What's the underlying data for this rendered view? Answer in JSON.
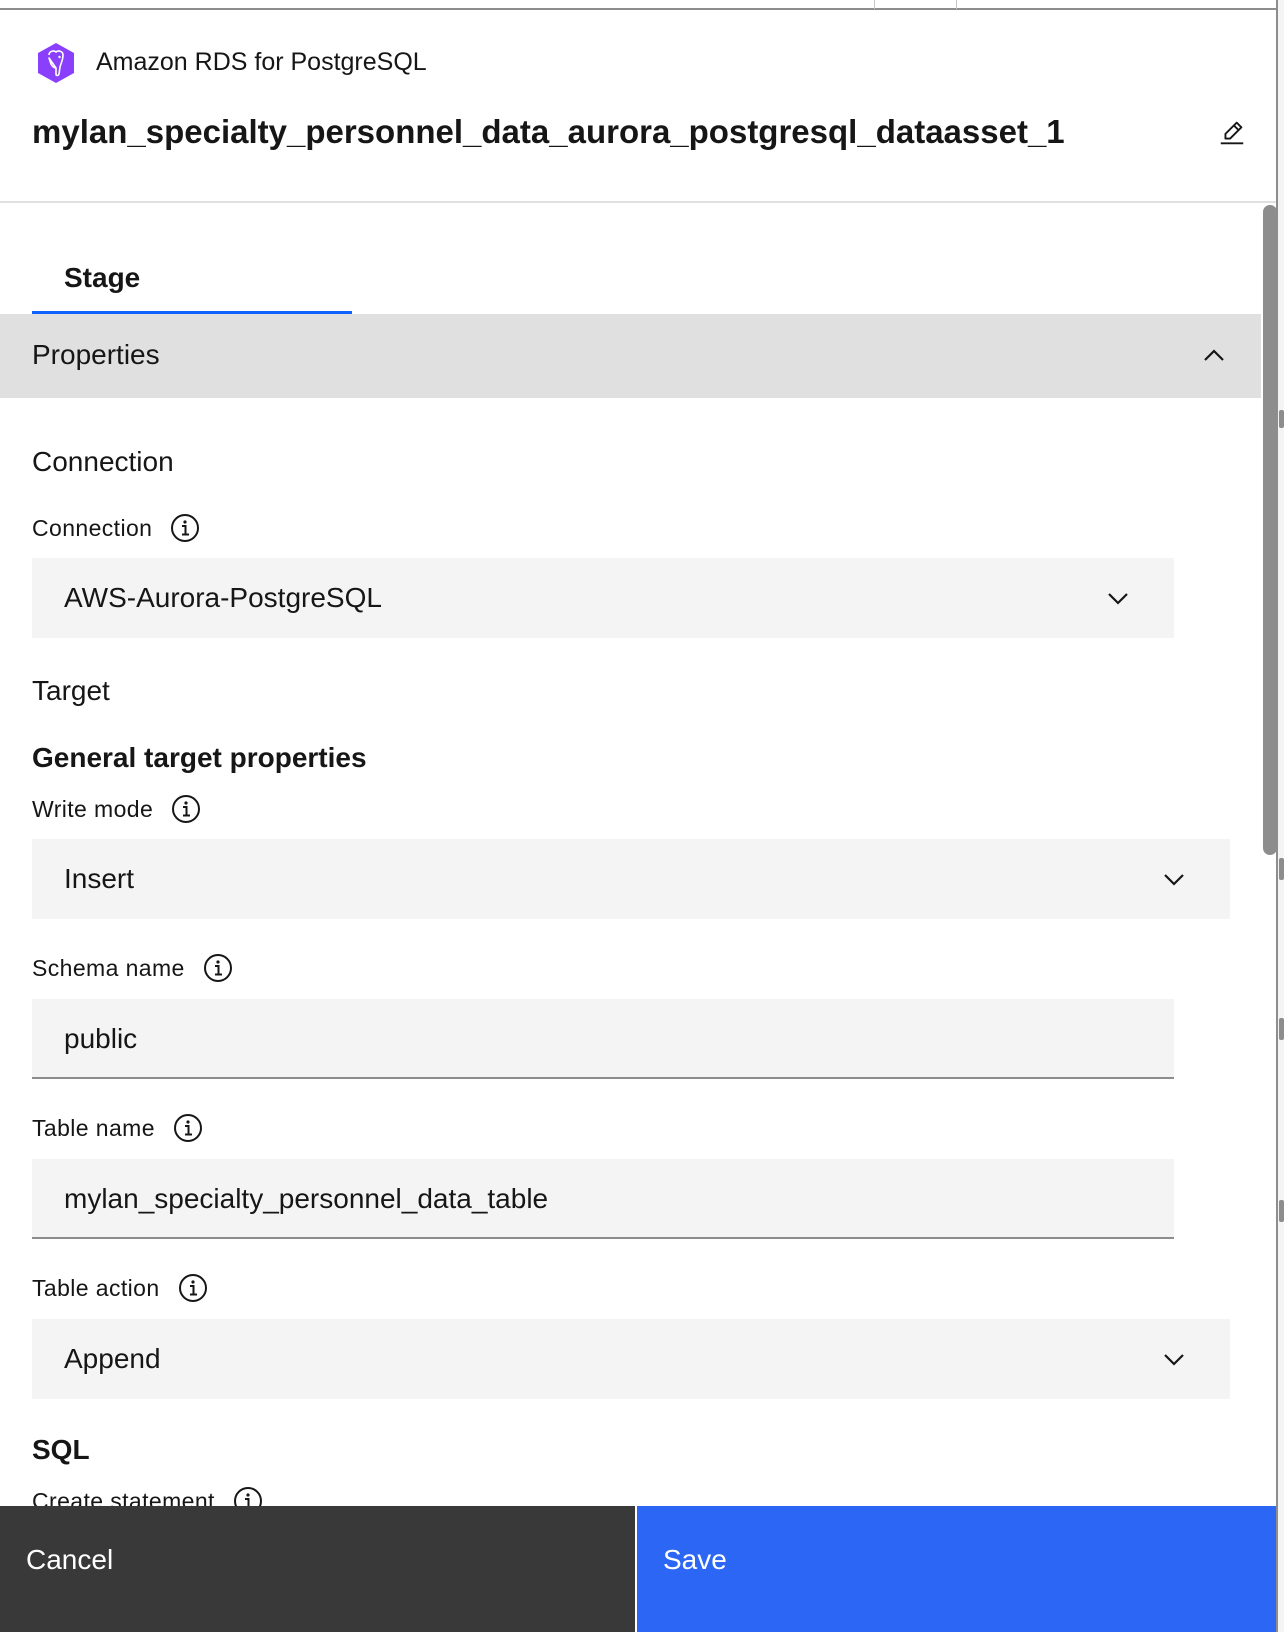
{
  "header": {
    "connection_type": "Amazon RDS for PostgreSQL",
    "asset_title": "mylan_specialty_personnel_data_aurora_postgresql_dataasset_1",
    "logo_icon": "postgresql-elephant-icon",
    "logo_color": "#8a3ffc"
  },
  "tabs": [
    {
      "label": "Stage",
      "selected": true
    }
  ],
  "accordion": {
    "title": "Properties",
    "expanded": true
  },
  "sections": {
    "connection_heading": "Connection",
    "target_heading": "Target",
    "general_target_heading": "General target properties",
    "sql_heading": "SQL"
  },
  "fields": {
    "connection": {
      "label": "Connection",
      "value": "AWS-Aurora-PostgreSQL"
    },
    "write_mode": {
      "label": "Write mode",
      "value": "Insert"
    },
    "schema_name": {
      "label": "Schema name",
      "value": "public"
    },
    "table_name": {
      "label": "Table name",
      "value": "mylan_specialty_personnel_data_table"
    },
    "table_action": {
      "label": "Table action",
      "value": "Append"
    },
    "create_statement": {
      "label": "Create statement"
    }
  },
  "footer": {
    "cancel_label": "Cancel",
    "save_label": "Save"
  },
  "colors": {
    "primary": "#2b66f5",
    "tab_underline": "#0f62fe",
    "secondary_button": "#393939",
    "field_bg": "#f4f4f4",
    "accordion_bg": "#e0e0e0"
  }
}
